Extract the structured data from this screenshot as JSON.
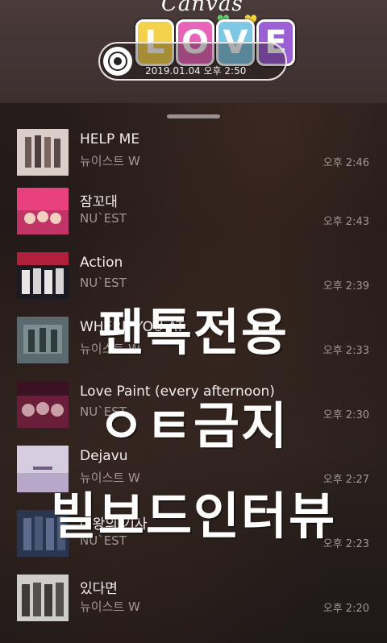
{
  "header": {
    "logo_top_text": "Canvas",
    "logo_letters": [
      "L",
      "O",
      "V",
      "E"
    ],
    "logo_colors": [
      "#f3d14a",
      "#e864b8",
      "#7ec8e3",
      "#9b5fd6"
    ],
    "date": "2019.01.04 오후 2:50"
  },
  "songs": [
    {
      "title": "HELP ME",
      "artist": "뉴이스트 W",
      "time": "오후 2:46"
    },
    {
      "title": "잠꼬대",
      "artist": "NU`EST",
      "time": "오후 2:43"
    },
    {
      "title": "Action",
      "artist": "NU`EST",
      "time": "오후 2:39"
    },
    {
      "title": "WHERE YOU AT",
      "artist": "뉴이스트 W",
      "time": "오후 2:33"
    },
    {
      "title": "Love Paint (every afternoon)",
      "artist": "NU`EST",
      "time": "오후 2:30"
    },
    {
      "title": "Dejavu",
      "artist": "뉴이스트 W",
      "time": "오후 2:27"
    },
    {
      "title": "여왕의 기사",
      "artist": "NU`EST",
      "time": "오후 2:23"
    },
    {
      "title": "있다면",
      "artist": "뉴이스트 W",
      "time": "오후 2:20"
    }
  ],
  "overlay": {
    "line1": "팬톡전용",
    "line2": "ㅇㅌ금지",
    "line3": "빌보드인터뷰"
  }
}
